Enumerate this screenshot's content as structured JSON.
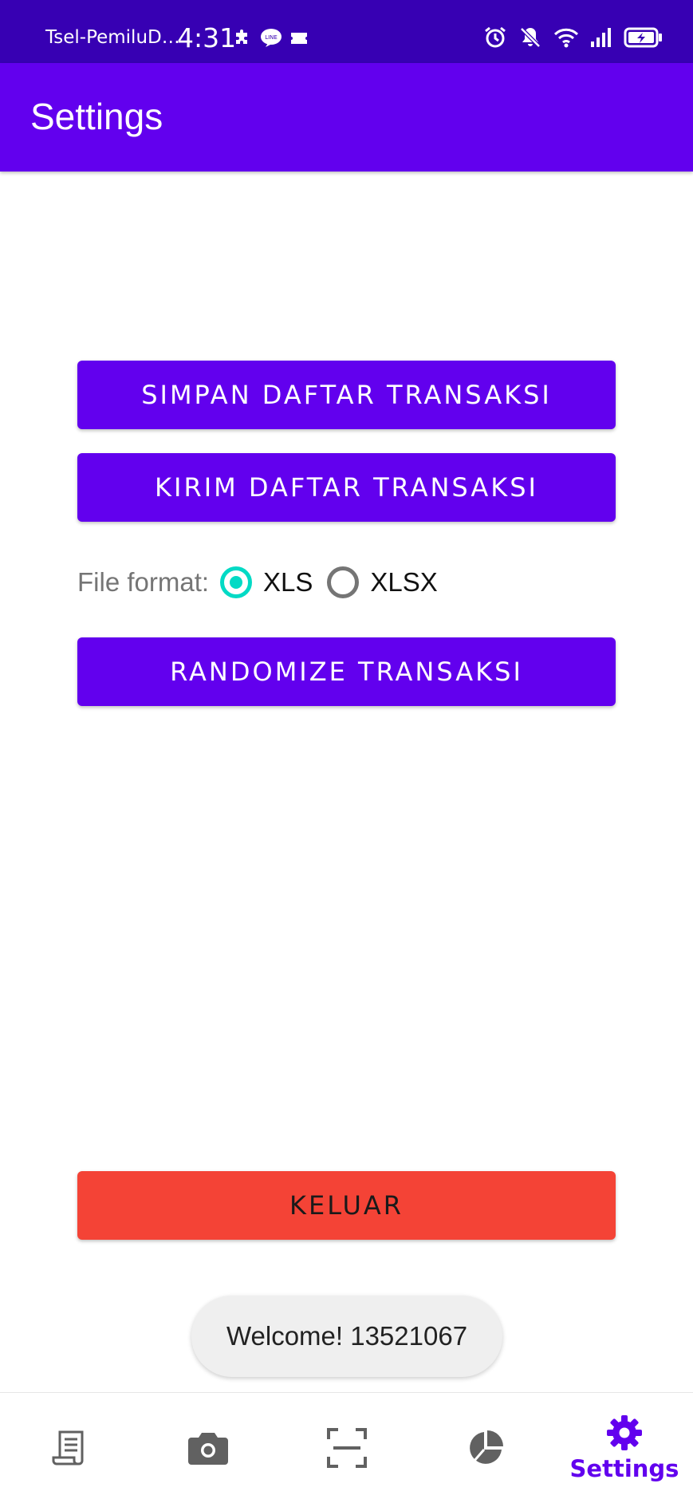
{
  "status_bar": {
    "carrier": "Tsel-PemiluD…",
    "time": "4:31"
  },
  "app_bar": {
    "title": "Settings"
  },
  "actions": {
    "save_label": "SIMPAN DAFTAR TRANSAKSI",
    "send_label": "KIRIM DAFTAR TRANSAKSI",
    "randomize_label": "RANDOMIZE TRANSAKSI",
    "logout_label": "KELUAR"
  },
  "file_format": {
    "label": "File format:",
    "options": [
      {
        "label": "XLS",
        "selected": true
      },
      {
        "label": "XLSX",
        "selected": false
      }
    ]
  },
  "toast": {
    "message": "Welcome! 13521067"
  },
  "bottom_nav": {
    "items": [
      {
        "icon": "receipt-icon",
        "label": ""
      },
      {
        "icon": "camera-icon",
        "label": ""
      },
      {
        "icon": "scan-icon",
        "label": ""
      },
      {
        "icon": "pie-chart-icon",
        "label": ""
      },
      {
        "icon": "gear-icon",
        "label": "Settings",
        "active": true
      }
    ]
  },
  "colors": {
    "status_bar": "#3700b3",
    "primary": "#6200ee",
    "accent": "#03dac5",
    "danger": "#f44336"
  }
}
